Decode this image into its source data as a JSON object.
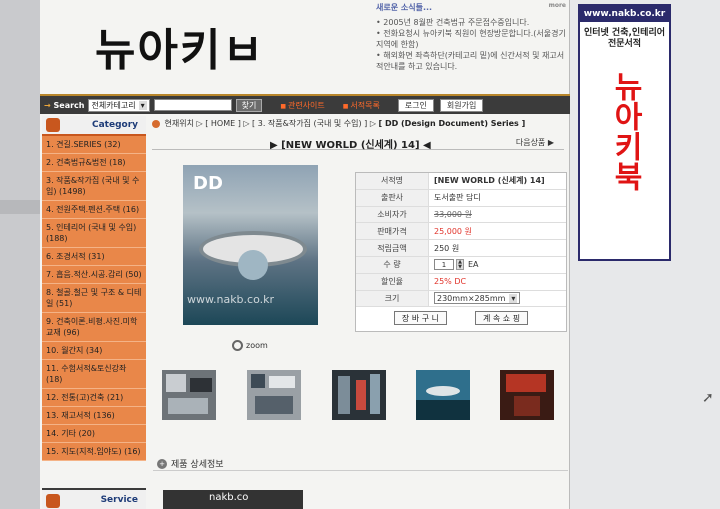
{
  "header": {
    "logo": "뉴아키ㅂ",
    "news_title": "새로운 소식들...",
    "news_more": "more",
    "news_items": [
      "2005년 8월판 건축법규 주문접수중입니다.",
      "전화요청시 뉴아키북 직원이 현장방문합니다.(서울경기지역에 한함)",
      "해외화면 좌측하단(카테고리 밑)에 신간서적 및 재고서적안내를 하고 있습니다."
    ]
  },
  "searchbar": {
    "label": "Search",
    "category_select": "전체카테고리",
    "search_button": "찾기",
    "link_related": "관련사이트",
    "link_catalog": "서적목록",
    "login_button": "로그인",
    "join_button": "회원가입"
  },
  "sidebar": {
    "category_title": "Category",
    "items": [
      "1. 견길.SERIES (32)",
      "2. 건축법규&법전 (18)",
      "3. 작품&작가집 (국내 및 수입) (1498)",
      "4. 전원주택.펜션.주택 (16)",
      "5. 인테리어 (국내 및 수입) (188)",
      "6. 조경서적 (31)",
      "7. 흡음.적산.시공.감리 (50)",
      "8. 철골.철근 및 구조 & 디테일 (51)",
      "9. 건축이론.비평.사진.미학교재 (96)",
      "10. 월간지 (34)",
      "11. 수험서적&토신강좌 (18)",
      "12. 전통(고)건축 (21)",
      "13. 재고서적 (136)",
      "14. 기타 (20)",
      "15. 지도(지적.임야도) (16)"
    ],
    "service_title": "Service"
  },
  "breadcrumb": {
    "text": "현재위치 ▷ [ HOME ] ▷ [ 3. 작품&작가집 (국내 및 수입) ] ▷",
    "current": "[ DD (Design Document) Series ]"
  },
  "product": {
    "title": "[NEW WORLD (신세계) 14]",
    "next_label": "다음상품",
    "cover_text": "DD",
    "cover_watermark": "www.nakb.co.kr",
    "zoom_label": "zoom",
    "details": [
      {
        "label": "서적명",
        "value": "[NEW WORLD (신세계) 14]"
      },
      {
        "label": "출판사",
        "value": "도서출판 담디"
      },
      {
        "label": "소비자가",
        "value": "33,000 원"
      },
      {
        "label": "판매가격",
        "value": "25,000 원"
      },
      {
        "label": "적립금액",
        "value": "250 원"
      }
    ],
    "qty_label": "수 량",
    "qty_value": "1",
    "qty_unit": "EA",
    "discount_label": "할인율",
    "discount_value": "25% DC",
    "size_label": "크기",
    "size_value": "230mm×285mm",
    "cart_button": "장 바 구 니",
    "order_button": "계 속 쇼 핑",
    "detail_section": "제품 상세정보"
  },
  "bottom_box_text": "nakb.co",
  "banner": {
    "url": "www.nakb.co.kr",
    "subtitle": "인터넷 건축,인테리어 전문서적",
    "vertical": "뉴아키북"
  },
  "colors": {
    "sidebar_orange": "#e98749",
    "price_red": "#e1342b",
    "nav_orange": "#ff6a2a",
    "banner_navy": "#2b2a6b"
  }
}
